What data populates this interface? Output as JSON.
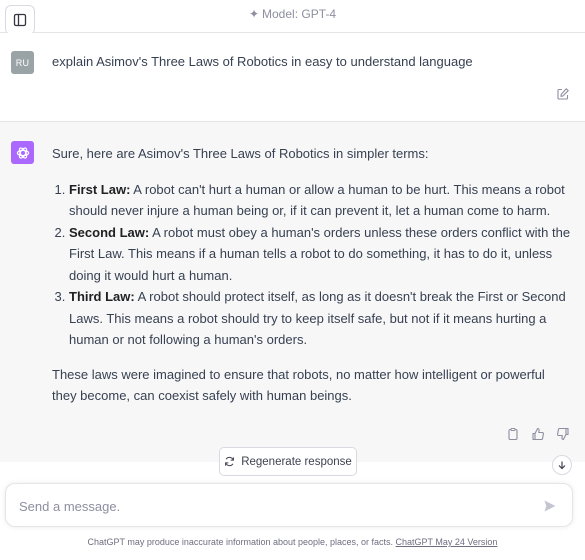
{
  "header": {
    "model_label": "Model: GPT-4",
    "sparkle_icon": "sparkle-icon",
    "sidebar_icon": "sidebar-toggle-icon"
  },
  "user_message": {
    "avatar_initials": "RU",
    "text": "explain Asimov's Three Laws of Robotics in easy to understand language"
  },
  "assistant_message": {
    "intro": "Sure, here are Asimov's Three Laws of Robotics in simpler terms:",
    "laws": [
      {
        "title": "First Law:",
        "text": " A robot can't hurt a human or allow a human to be hurt. This means a robot should never injure a human being or, if it can prevent it, let a human come to harm."
      },
      {
        "title": "Second Law:",
        "text": " A robot must obey a human's orders unless these orders conflict with the First Law. This means if a human tells a robot to do something, it has to do it, unless doing it would hurt a human."
      },
      {
        "title": "Third Law:",
        "text": " A robot should protect itself, as long as it doesn't break the First or Second Laws. This means a robot should try to keep itself safe, but not if it means hurting a human or not following a human's orders."
      }
    ],
    "closing": "These laws were imagined to ensure that robots, no matter how intelligent or powerful they become, can coexist safely with human beings."
  },
  "actions": {
    "regenerate_label": "Regenerate response"
  },
  "composer": {
    "placeholder": "Send a message."
  },
  "footer": {
    "disclaimer": "ChatGPT may produce inaccurate information about people, places, or facts. ",
    "version_link": "ChatGPT May 24 Version"
  },
  "colors": {
    "accent_gpt_avatar": "#ab68ff",
    "user_avatar": "#9aa4a6",
    "assistant_bg": "#f7f7f8"
  }
}
